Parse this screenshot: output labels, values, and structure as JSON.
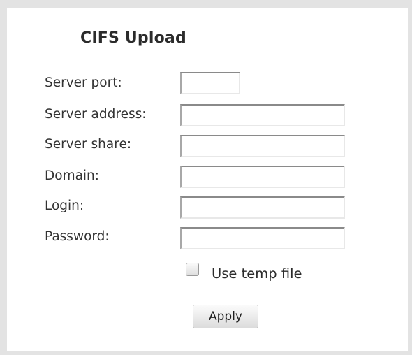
{
  "panel": {
    "title": "CIFS Upload"
  },
  "form": {
    "server_port": {
      "label": "Server port:",
      "value": ""
    },
    "server_address": {
      "label": "Server address:",
      "value": ""
    },
    "server_share": {
      "label": "Server share:",
      "value": ""
    },
    "domain": {
      "label": "Domain:",
      "value": ""
    },
    "login": {
      "label": "Login:",
      "value": ""
    },
    "password": {
      "label": "Password:",
      "value": ""
    },
    "use_temp_file": {
      "label": "Use temp file",
      "checked": false
    },
    "apply_label": "Apply"
  },
  "colors": {
    "frame": "#e3e3e3",
    "text": "#333333",
    "background": "#ffffff"
  }
}
